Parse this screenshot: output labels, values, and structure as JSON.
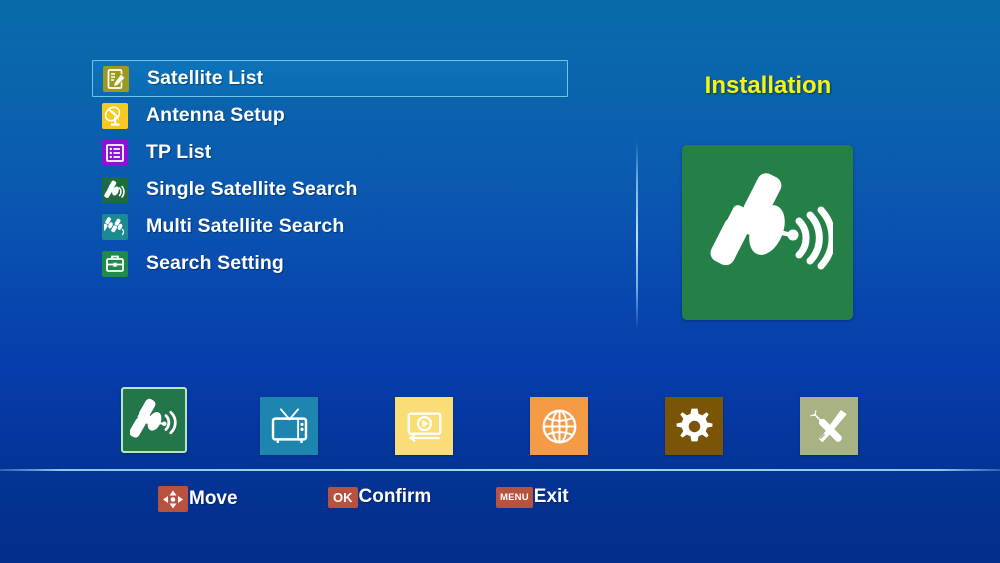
{
  "panel": {
    "title": "Installation",
    "hero_icon": "satellite-dish-icon",
    "hero_bg": "#258048"
  },
  "menu": {
    "items": [
      {
        "label": "Satellite List",
        "icon": "satellite-list-edit-icon",
        "icon_bg": "#9a9a1e",
        "selected": true
      },
      {
        "label": "Antenna Setup",
        "icon": "antenna-dish-icon",
        "icon_bg": "#f5c91e",
        "selected": false
      },
      {
        "label": "TP List",
        "icon": "transponder-list-icon",
        "icon_bg": "#8b10d8",
        "selected": false
      },
      {
        "label": "Single Satellite Search",
        "icon": "single-satellite-icon",
        "icon_bg": "#1d6b42",
        "selected": false
      },
      {
        "label": "Multi Satellite Search",
        "icon": "multi-satellite-icon",
        "icon_bg": "#1b8a93",
        "selected": false
      },
      {
        "label": "Search Setting",
        "icon": "toolbox-icon",
        "icon_bg": "#1f8a4c",
        "selected": false
      }
    ]
  },
  "icon_bar": {
    "items": [
      {
        "name": "installation",
        "icon": "satellite-icon",
        "bg": "#23764a",
        "active": true
      },
      {
        "name": "channel",
        "icon": "tv-icon",
        "bg": "#1e86ae",
        "active": false
      },
      {
        "name": "media",
        "icon": "media-play-icon",
        "bg": "#fadd76",
        "active": false
      },
      {
        "name": "network",
        "icon": "globe-icon",
        "bg": "#f59b46",
        "active": false
      },
      {
        "name": "system-setup",
        "icon": "gear-icon",
        "bg": "#7a5508",
        "active": false
      },
      {
        "name": "tools",
        "icon": "tools-icon",
        "bg": "#a7b382",
        "active": false
      }
    ]
  },
  "hints": [
    {
      "key": "▲▼◀▶",
      "key_icon": "dpad-icon",
      "label": "Move"
    },
    {
      "key": "OK",
      "key_icon": "ok-key",
      "label": "Confirm"
    },
    {
      "key": "MENU",
      "key_icon": "menu-key",
      "label": "Exit"
    }
  ],
  "colors": {
    "accent_yellow": "#f5f315",
    "badge_red": "#b9513f",
    "highlight_border": "#6fc4ea",
    "separator": "#a5d7fa"
  }
}
